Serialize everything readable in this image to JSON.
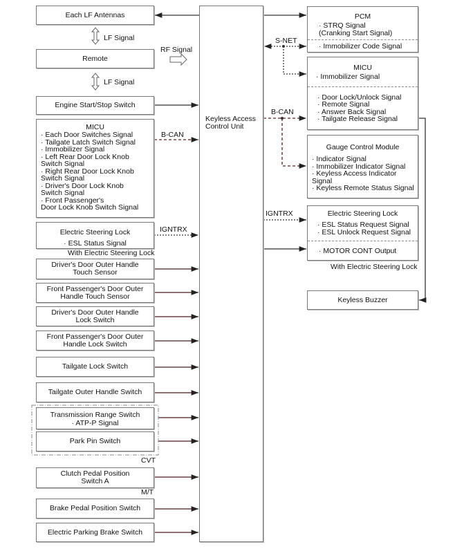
{
  "center": {
    "label": "Keyless Access Control Unit"
  },
  "left": {
    "lf_antennas": "Each LF Antennas",
    "lf_signal_1": "LF Signal",
    "remote": "Remote",
    "rf_signal": "RF Signal",
    "lf_signal_2": "LF Signal",
    "engine_switch": "Engine Start/Stop Switch",
    "micu": {
      "title": "MICU",
      "signals": [
        "· Each Door Switches Signal",
        "· Tailgate Latch Switch Signal",
        "· Immobilizer Signal",
        "· Left Rear Door Lock Knob",
        "Switch Signal",
        "· Right Rear Door Lock Knob",
        "Switch Signal",
        "· Driver's Door Lock Knob",
        "Switch Signal",
        "· Front Passenger's",
        "Door Lock Knob Switch Signal"
      ],
      "bus": "B-CAN"
    },
    "esl": {
      "title": "Electric Steering Lock",
      "signal": "· ESL Status Signal",
      "bus": "IGNTRX",
      "note": "With Electric Steering Lock"
    },
    "switches": [
      "Driver's Door Outer Handle\nTouch Sensor",
      "Front Passenger's Door Outer\nHandle Touch Sensor",
      "Driver's Door Outer Handle\nLock Switch",
      "Front Passenger's Door Outer\nHandle Lock Switch",
      "Tailgate Lock Switch",
      "Tailgate Outer Handle Switch"
    ],
    "trans": {
      "title": "Transmission Range Switch",
      "signal": "· ATP-P Signal"
    },
    "park_pin": "Park Pin Switch",
    "cvt": "CVT",
    "clutch": "Clutch Pedal Position\nSwitch A",
    "mt": "M/T",
    "brake": "Brake Pedal Position Switch",
    "epb": "Electric Parking Brake Switch"
  },
  "right": {
    "pcm": {
      "title": "PCM",
      "signals": [
        "· STRQ Signal",
        "(Cranking Start Signal)"
      ],
      "code": "· Immobilizer Code Signal",
      "bus": "S-NET"
    },
    "micu": {
      "title": "MICU",
      "immo": "· Immobilizer Signal",
      "signals": [
        "· Door Lock/Unlock Signal",
        "· Remote Signal",
        "· Answer Back Signal",
        "· Tailgate Release Signal"
      ],
      "bus": "B-CAN"
    },
    "gauge": {
      "title": "Gauge Control Module",
      "signals": [
        "· Indicator Signal",
        "· Immobilizer Indicator Signal",
        "· Keyless Access Indicator",
        "Signal",
        "· Keyless Remote Status Signal"
      ]
    },
    "esl": {
      "title": "Electric Steering Lock",
      "signals": [
        "· ESL Status Request Signal",
        "· ESL Unlock Request Signal"
      ],
      "motor": "· MOTOR CONT Output",
      "bus": "IGNTRX",
      "note": "With Electric Steering Lock"
    },
    "buzzer": "Keyless Buzzer"
  }
}
